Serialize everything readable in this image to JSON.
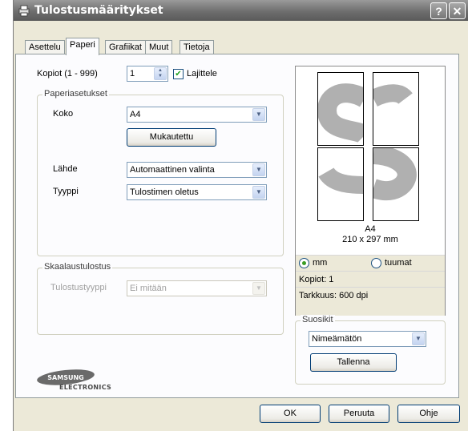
{
  "window": {
    "title": "Tulostusmääritykset"
  },
  "titlebar_buttons": {
    "help": "?",
    "close": "✕"
  },
  "tabs": [
    {
      "label": "Asettelu"
    },
    {
      "label": "Paperi"
    },
    {
      "label": "Grafiikat"
    },
    {
      "label": "Muut"
    },
    {
      "label": "Tietoja"
    }
  ],
  "active_tab": "Paperi",
  "copies": {
    "label": "Kopiot (1 - 999)",
    "value": "1",
    "collate_label": "Lajittele",
    "collate_checked": true
  },
  "paper_settings": {
    "legend": "Paperiasetukset",
    "size_label": "Koko",
    "size_value": "A4",
    "custom_button": "Mukautettu",
    "source_label": "Lähde",
    "source_value": "Automaattinen valinta",
    "type_label": "Tyyppi",
    "type_value": "Tulostimen oletus"
  },
  "scaling": {
    "legend": "Skaalaustulostus",
    "type_label": "Tulostustyyppi",
    "type_value": "Ei mitään",
    "disabled": true
  },
  "preview": {
    "paper_name": "A4",
    "paper_dims": "210 x 297 mm",
    "unit_mm": "mm",
    "unit_inch": "tuumat",
    "selected_unit": "mm",
    "copies_text": "Kopiot: 1",
    "resolution_text": "Tarkkuus: 600 dpi",
    "glyph": "S"
  },
  "favorites": {
    "legend": "Suosikit",
    "value": "Nimeämätön",
    "save_button": "Tallenna"
  },
  "logo": {
    "brand": "SAMSUNG",
    "sub": "ELECTRONICS"
  },
  "footer": {
    "ok": "OK",
    "cancel": "Peruuta",
    "help": "Ohje"
  },
  "colors": {
    "titlebar": "#6e6e6e",
    "dialog": "#ece9d8",
    "panel": "#fcfcfe",
    "preview_glyph": "#b0b0b0"
  }
}
